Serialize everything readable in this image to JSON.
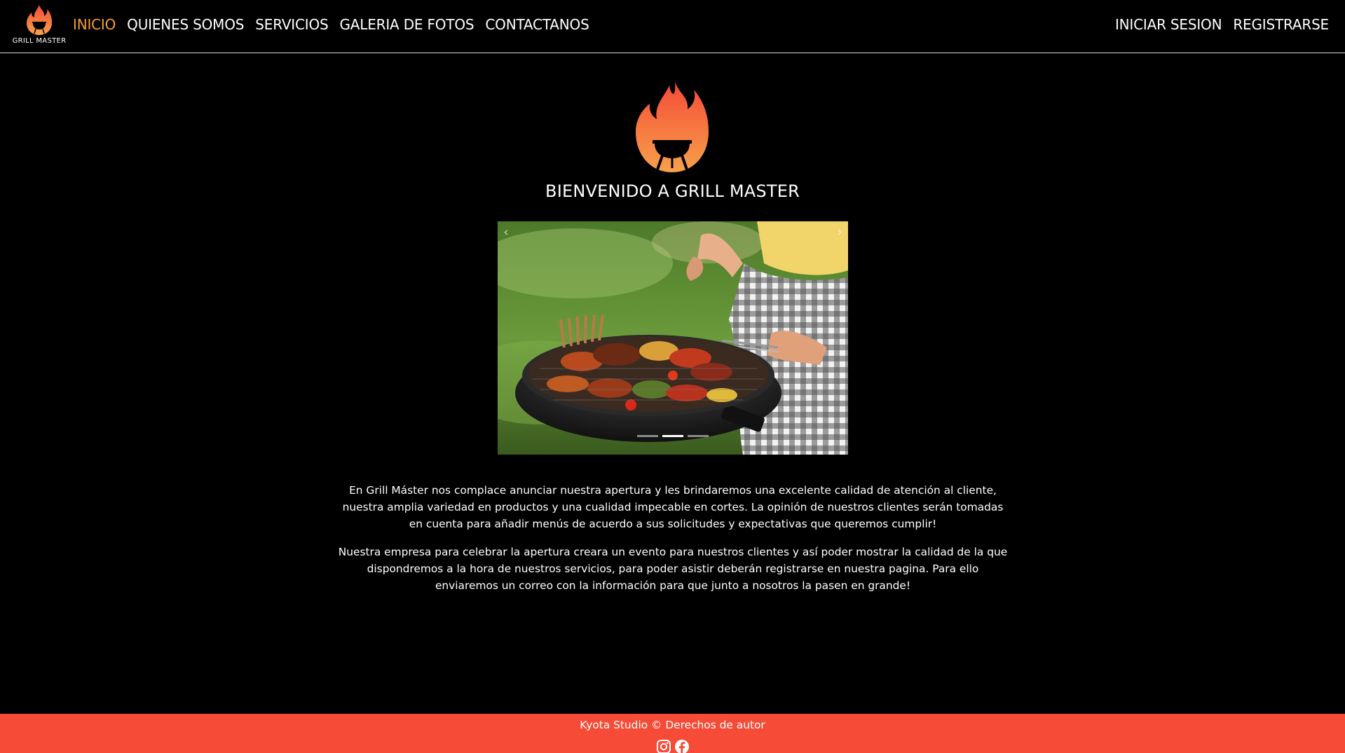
{
  "brand": {
    "name": "GRILL MASTER"
  },
  "nav": {
    "left": [
      {
        "label": "INICIO",
        "active": true
      },
      {
        "label": "QUIENES SOMOS",
        "active": false
      },
      {
        "label": "SERVICIOS",
        "active": false
      },
      {
        "label": "GALERIA DE FOTOS",
        "active": false
      },
      {
        "label": "CONTACTANOS",
        "active": false
      }
    ],
    "right": [
      {
        "label": "INICIAR SESION"
      },
      {
        "label": "REGISTRARSE"
      }
    ]
  },
  "hero": {
    "title": "BIENVENIDO A GRILL MASTER"
  },
  "carousel": {
    "prev_icon": "chevron-left-icon",
    "next_icon": "chevron-right-icon",
    "slide_count": 3,
    "active_index": 1
  },
  "content": {
    "paragraph1": "En Grill Máster nos complace anunciar nuestra apertura y les brindaremos una excelente calidad de atención al cliente, nuestra amplia variedad en productos y una cualidad impecable en cortes. La opinión de nuestros clientes serán tomadas en cuenta para añadir menús de acuerdo a sus solicitudes y expectativas que queremos cumplir!",
    "paragraph2": "Nuestra empresa para celebrar la apertura creara un evento para nuestros clientes y así poder mostrar la calidad de la que dispondremos a la hora de nuestros servicios, para poder asistir deberán registrarse en nuestra pagina. Para ello enviaremos un correo con la información para que junto a nosotros la pasen en grande!"
  },
  "footer": {
    "text": "Kyota Studio © Derechos de autor",
    "social": [
      "instagram-icon",
      "facebook-icon"
    ]
  },
  "colors": {
    "accent": "#f5a02e",
    "footer_bg": "#f54b37",
    "flame_top": "#f54b37",
    "flame_bottom": "#f7a14a"
  }
}
